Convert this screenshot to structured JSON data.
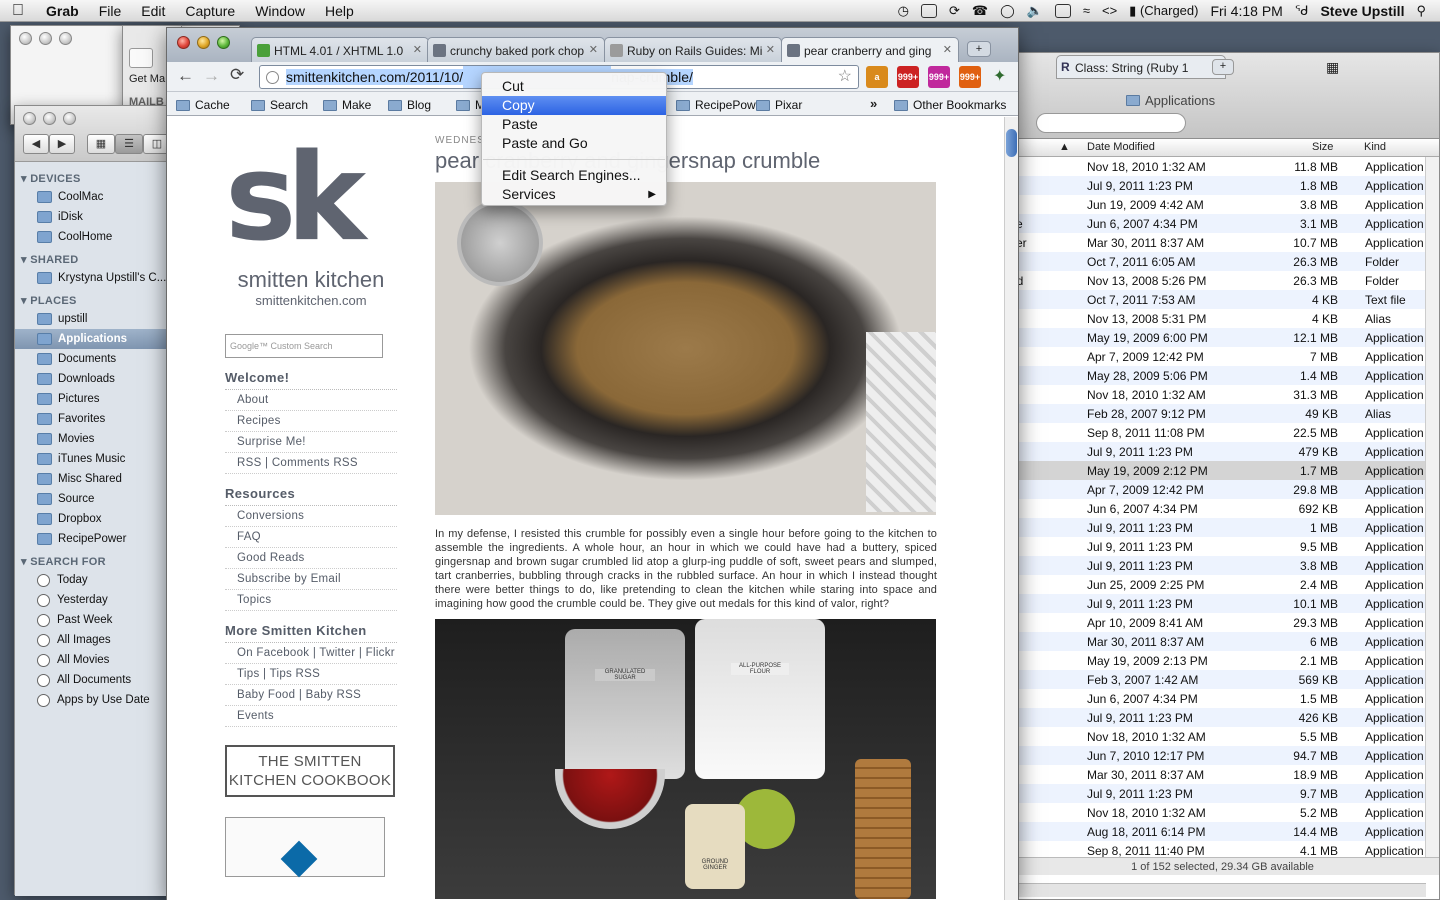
{
  "menubar": {
    "app": "Grab",
    "items": [
      "File",
      "Edit",
      "Capture",
      "Window",
      "Help"
    ],
    "battery": "(Charged)",
    "clock": "Fri 4:18 PM",
    "user": "Steve Upstill"
  },
  "back_windows": {
    "mail_get_label": "Get Ma",
    "mail_label": "MAILB"
  },
  "finder_sidebar": {
    "devices_header": "DEVICES",
    "devices": [
      "CoolMac",
      "iDisk",
      "CoolHome"
    ],
    "shared_header": "SHARED",
    "shared": [
      "Krystyna Upstill's C..."
    ],
    "places_header": "PLACES",
    "places": [
      "upstill",
      "Applications",
      "Documents",
      "Downloads",
      "Pictures",
      "Favorites",
      "Movies",
      "iTunes Music",
      "Misc Shared",
      "Source",
      "Dropbox",
      "RecipePower"
    ],
    "selected_place": "Applications",
    "search_header": "SEARCH FOR",
    "search": [
      "Today",
      "Yesterday",
      "Past Week",
      "All Images",
      "All Movies",
      "All Documents",
      "Apps by Use Date"
    ]
  },
  "finder_main": {
    "tab_title": "Class: String (Ruby 1",
    "title": "Applications",
    "columns": {
      "date": "Date Modified",
      "size": "Size",
      "kind": "Kind"
    },
    "partial_names": [
      "",
      "",
      "",
      "ate",
      "ater",
      "",
      "ard",
      "",
      "",
      "",
      "",
      "",
      "",
      "",
      "",
      "",
      "",
      "",
      "",
      "",
      "",
      "",
      "",
      "",
      "",
      "",
      "",
      "",
      "",
      "",
      "",
      "",
      "",
      "",
      "",
      "",
      "",
      ""
    ],
    "rows": [
      [
        "Nov 18, 2010 1:32 AM",
        "11.8 MB",
        "Application"
      ],
      [
        "Jul 9, 2011 1:23 PM",
        "1.8 MB",
        "Application"
      ],
      [
        "Jun 19, 2009 4:42 AM",
        "3.8 MB",
        "Application"
      ],
      [
        "Jun 6, 2007 4:34 PM",
        "3.1 MB",
        "Application"
      ],
      [
        "Mar 30, 2011 8:37 AM",
        "10.7 MB",
        "Application"
      ],
      [
        "Oct 7, 2011 6:05 AM",
        "26.3 MB",
        "Folder"
      ],
      [
        "Nov 13, 2008 5:26 PM",
        "26.3 MB",
        "Folder"
      ],
      [
        "Oct 7, 2011 7:53 AM",
        "4 KB",
        "Text file"
      ],
      [
        "Nov 13, 2008 5:31 PM",
        "4 KB",
        "Alias"
      ],
      [
        "May 19, 2009 6:00 PM",
        "12.1 MB",
        "Application"
      ],
      [
        "Apr 7, 2009 12:42 PM",
        "7 MB",
        "Application"
      ],
      [
        "May 28, 2009 5:06 PM",
        "1.4 MB",
        "Application"
      ],
      [
        "Nov 18, 2010 1:32 AM",
        "31.3 MB",
        "Application"
      ],
      [
        "Feb 28, 2007 9:12 PM",
        "49 KB",
        "Alias"
      ],
      [
        "Sep 8, 2011 11:08 PM",
        "22.5 MB",
        "Application"
      ],
      [
        "Jul 9, 2011 1:23 PM",
        "479 KB",
        "Application"
      ],
      [
        "May 19, 2009 2:12 PM",
        "1.7 MB",
        "Application"
      ],
      [
        "Apr 7, 2009 12:42 PM",
        "29.8 MB",
        "Application"
      ],
      [
        "Jun 6, 2007 4:34 PM",
        "692 KB",
        "Application"
      ],
      [
        "Jul 9, 2011 1:23 PM",
        "1 MB",
        "Application"
      ],
      [
        "Jul 9, 2011 1:23 PM",
        "9.5 MB",
        "Application"
      ],
      [
        "Jul 9, 2011 1:23 PM",
        "3.8 MB",
        "Application"
      ],
      [
        "Jun 25, 2009 2:25 PM",
        "2.4 MB",
        "Application"
      ],
      [
        "Jul 9, 2011 1:23 PM",
        "10.1 MB",
        "Application"
      ],
      [
        "Apr 10, 2009 8:41 AM",
        "29.3 MB",
        "Application"
      ],
      [
        "Mar 30, 2011 8:37 AM",
        "6 MB",
        "Application"
      ],
      [
        "May 19, 2009 2:13 PM",
        "2.1 MB",
        "Application"
      ],
      [
        "Feb 3, 2007 1:42 AM",
        "569 KB",
        "Application"
      ],
      [
        "Jun 6, 2007 4:34 PM",
        "1.5 MB",
        "Application"
      ],
      [
        "Jul 9, 2011 1:23 PM",
        "426 KB",
        "Application"
      ],
      [
        "Nov 18, 2010 1:32 AM",
        "5.5 MB",
        "Application"
      ],
      [
        "Jun 7, 2010 12:17 PM",
        "94.7 MB",
        "Application"
      ],
      [
        "Mar 30, 2011 8:37 AM",
        "18.9 MB",
        "Application"
      ],
      [
        "Jul 9, 2011 1:23 PM",
        "9.7 MB",
        "Application"
      ],
      [
        "Nov 18, 2010 1:32 AM",
        "5.2 MB",
        "Application"
      ],
      [
        "Aug 18, 2011 6:14 PM",
        "14.4 MB",
        "Application"
      ],
      [
        "Sep 8, 2011 11:40 PM",
        "4.1 MB",
        "Application"
      ]
    ],
    "highlighted_row": 16,
    "status": "1 of 152 selected, 29.34 GB available"
  },
  "browser": {
    "tabs": [
      {
        "title": "HTML 4.01 / XHTML 1.0",
        "fav_color": "#4aa03a"
      },
      {
        "title": "crunchy baked pork chop",
        "fav_color": "#6b7381"
      },
      {
        "title": "Ruby on Rails Guides: Mi",
        "fav_color": "#9b9b9b"
      },
      {
        "title": "pear cranberry and ging",
        "fav_color": "#6b7381"
      }
    ],
    "active_tab": 3,
    "url_start": "smittenkitchen.com/2011/10/",
    "url_end": "nap-crumble/",
    "bookmarks": [
      "Cache",
      "Search",
      "Make",
      "Blog",
      "Mis",
      "RecipePower",
      "Pixar"
    ],
    "other_bookmarks": "Other Bookmarks",
    "extensions": [
      {
        "label": "a",
        "color": "#d98a1c"
      },
      {
        "label": "999+",
        "color": "#cc2222"
      },
      {
        "label": "999+",
        "color": "#c0299c"
      },
      {
        "label": "999+",
        "color": "#e06010"
      }
    ]
  },
  "context_menu": {
    "items": [
      "Cut",
      "Copy",
      "Paste",
      "Paste and Go"
    ],
    "items2": [
      "Edit Search Engines...",
      "Services"
    ],
    "selected": "Copy"
  },
  "site": {
    "logo": "sk",
    "name": "smitten kitchen",
    "url": "smittenkitchen.com",
    "search_placeholder": "Google™ Custom Search",
    "sections": [
      {
        "title": "Welcome!",
        "links": [
          "About",
          "Recipes",
          "Surprise Me!",
          "RSS | Comments RSS"
        ]
      },
      {
        "title": "Resources",
        "links": [
          "Conversions",
          "FAQ",
          "Good Reads",
          "Subscribe by Email",
          "Topics"
        ]
      },
      {
        "title": "More Smitten Kitchen",
        "links": [
          "On Facebook | Twitter | Flickr",
          "Tips | Tips RSS",
          "Baby Food | Baby RSS",
          "Events"
        ]
      }
    ],
    "cookbook": "THE SMITTEN KITCHEN COOKBOOK",
    "post_date": "WEDNES",
    "post_title": "pear cranberry and gingersnap crumble",
    "post_text": "In my defense, I resisted this crumble for possibly even a single hour before going to the kitchen to assemble the ingredients. A whole hour, an hour in which we could have had a buttery, spiced gingersnap and brown sugar crumbled lid atop a glurp-ing puddle of soft, sweet pears and slumped, tart cranberries, bubbling through cracks in the rubbled surface. An hour in which I instead thought there were better things to do, like pretending to clean the kitchen while staring into space and imagining how good the crumble could be. They give out medals for this kind of valor, right?",
    "jar_labels": [
      "GRANULATED SUGAR",
      "ALL-PURPOSE FLOUR",
      "GROUND GINGER"
    ]
  }
}
